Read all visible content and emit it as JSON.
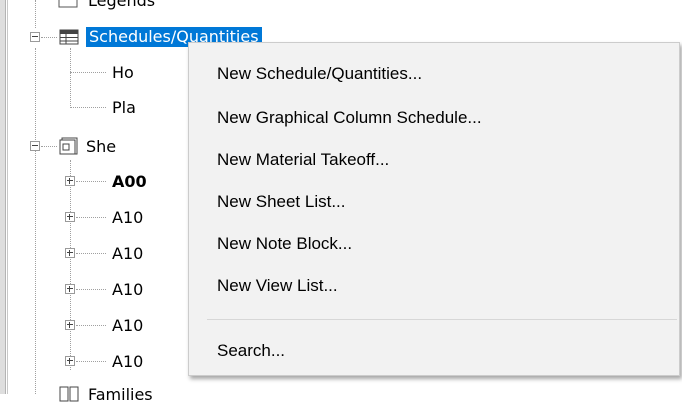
{
  "tree": {
    "legends_label": "Legends",
    "schedules_label": "Schedules/Quantities",
    "sched_child1": "Ho",
    "sched_child2": "Pla",
    "sheets_label": "She",
    "sheet_items": [
      "A00",
      "A10",
      "A10",
      "A10",
      "A10",
      "A10"
    ],
    "families_label": "Families"
  },
  "context_menu": {
    "items": [
      "New Schedule/Quantities...",
      "New Graphical Column Schedule...",
      "New Material Takeoff...",
      "New Sheet List...",
      "New Note Block...",
      "New View List..."
    ],
    "search_label": "Search..."
  }
}
